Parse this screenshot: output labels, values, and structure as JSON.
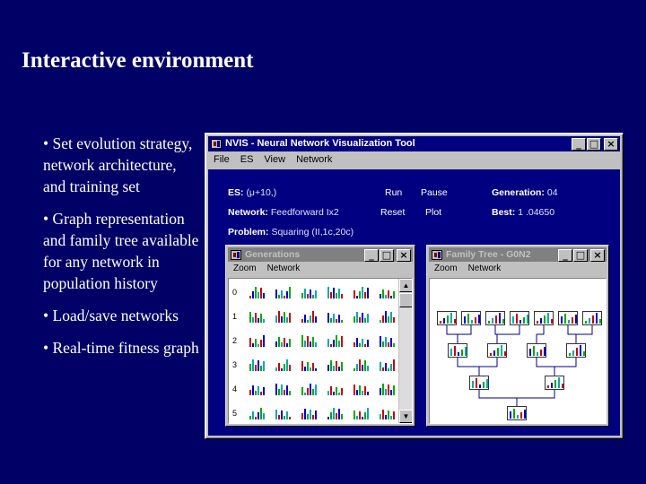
{
  "slide": {
    "title": "Interactive environment",
    "bullets": [
      "• Set evolution strategy, network architecture, and training set",
      "• Graph representation and family tree available for any network in population history",
      "• Load/save networks",
      "• Real-time fitness graph"
    ]
  },
  "main_window": {
    "title": "NVIS - Neural Network Visualization Tool",
    "menu": [
      "File",
      "ES",
      "View",
      "Network"
    ],
    "controls": {
      "es_label": "ES:",
      "es_value": "(μ+10,)",
      "network_label": "Network:",
      "network_value": "Feedforward Ix2",
      "problem_label": "Problem:",
      "problem_value": "Squaring (II,1c,20c)",
      "run_label": "Run",
      "pause_label": "Pause",
      "reset_label": "Reset",
      "plot_label": "Plot",
      "generation_label": "Generation:",
      "generation_value": "04",
      "best_label": "Best:",
      "best_value": "1 .04650"
    }
  },
  "generations_window": {
    "title": "Generations",
    "menu": [
      "Zoom",
      "Network"
    ],
    "row_labels": [
      "0",
      "1",
      "2",
      "3",
      "4",
      "5"
    ]
  },
  "family_tree_window": {
    "title": "Family Tree - G0N2",
    "menu": [
      "Zoom",
      "Network"
    ]
  },
  "colors": {
    "slide_bg": "#000066",
    "titlebar_active": "#000080",
    "bar_red": "#cc0000",
    "bar_blue": "#0000cc",
    "bar_green": "#00aa00",
    "bar_cyan": "#00aaaa"
  }
}
